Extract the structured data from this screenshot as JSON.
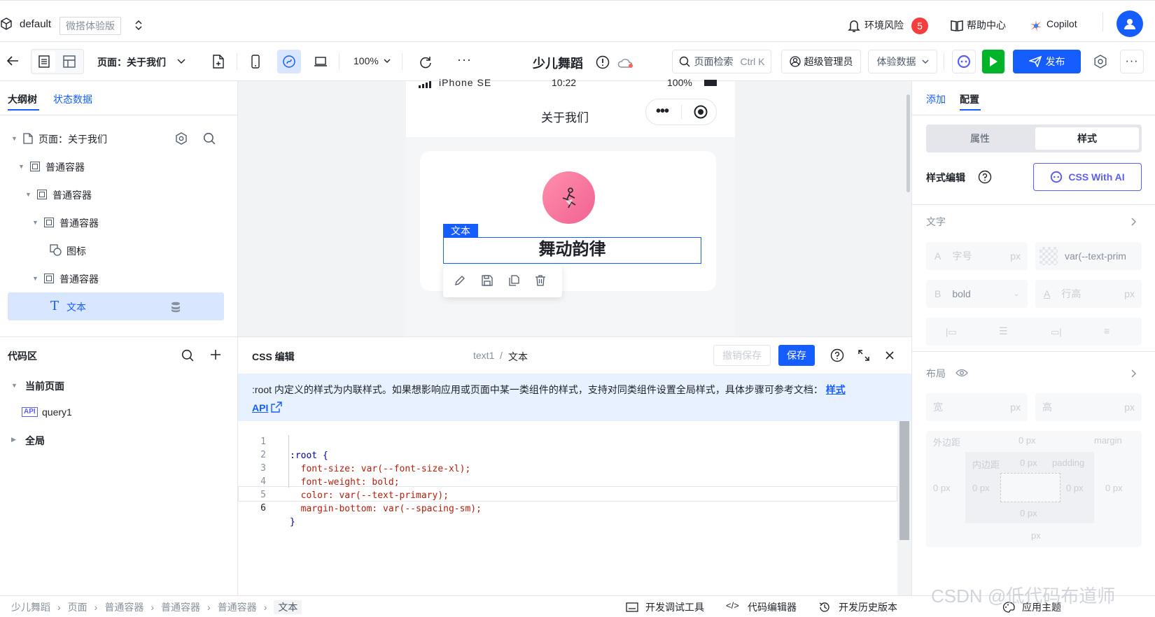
{
  "topbar": {
    "workspace": "default",
    "edition_tag": "微搭体验版",
    "risk_label": "环境风险",
    "risk_count": "5",
    "help_label": "帮助中心",
    "copilot_label": "Copilot"
  },
  "toolbar": {
    "page_selector": "页面：关于我们",
    "zoom": "100%",
    "app_name": "少儿舞蹈",
    "search_placeholder": "页面检索",
    "search_shortcut": "Ctrl K",
    "admin_label": "超级管理员",
    "data_label": "体验数据",
    "publish_label": "发布"
  },
  "left": {
    "tabs": [
      "大纲树",
      "状态数据"
    ],
    "tree": [
      {
        "label": "页面：关于我们"
      },
      {
        "label": "普通容器"
      },
      {
        "label": "普通容器"
      },
      {
        "label": "普通容器"
      },
      {
        "label": "图标"
      },
      {
        "label": "普通容器"
      },
      {
        "label": "文本"
      }
    ],
    "code_area_title": "代码区",
    "current_page": "当前页面",
    "query": "query1",
    "global": "全局"
  },
  "phone": {
    "carrier": "iPhone SE",
    "time": "10:22",
    "battery": "100%",
    "nav_title": "关于我们",
    "selected_tag": "文本",
    "heading": "舞动韵律"
  },
  "editor": {
    "title": "CSS 编辑",
    "breadcrumb_id": "text1",
    "breadcrumb_sep": "/",
    "breadcrumb_name": "文本",
    "undo_label": "撤销保存",
    "save_label": "保存",
    "notice": ":root 内定义的样式为内联样式。如果想影响应用或页面中某一类组件的样式，支持对同类组件设置全局样式，具体步骤可参考文档：",
    "notice_link1": "样式",
    "notice_link2": "API",
    "lines": [
      {
        "n": "1",
        "code": ":root {"
      },
      {
        "n": "2",
        "code": "  font-size: var(--font-size-xl);"
      },
      {
        "n": "3",
        "code": "  font-weight: bold;"
      },
      {
        "n": "4",
        "code": "  color: var(--text-primary);"
      },
      {
        "n": "5",
        "code": "  margin-bottom: var(--spacing-sm);"
      },
      {
        "n": "6",
        "code": "}"
      }
    ]
  },
  "right": {
    "tabs": [
      "添加",
      "配置"
    ],
    "segments": [
      "属性",
      "样式"
    ],
    "style_edit": "样式编辑",
    "css_ai": "CSS With AI",
    "text_section": "文字",
    "font_size_ph": "字号",
    "unit": "px",
    "color_var": "var(--text-prim",
    "weight": "bold",
    "line_height_ph": "行高",
    "layout_section": "布局",
    "width_label": "宽",
    "height_label": "高",
    "margin_label": "外边距",
    "margin_en": "margin",
    "padding_label": "内边距",
    "padding_en": "padding",
    "zero": "0 px"
  },
  "status": {
    "crumbs": [
      "少儿舞蹈",
      "页面",
      "普通容器",
      "普通容器",
      "普通容器",
      "文本"
    ],
    "dev_tools": "开发调试工具",
    "code_editor": "代码编辑器",
    "history": "开发历史版本",
    "theme": "应用主题",
    "watermark": "CSDN @低代码布道师"
  },
  "colors": {
    "primary": "#165dff",
    "green": "#00b42a",
    "selected_bg": "#d9e6ff",
    "notice_bg": "#e8f1ff"
  }
}
